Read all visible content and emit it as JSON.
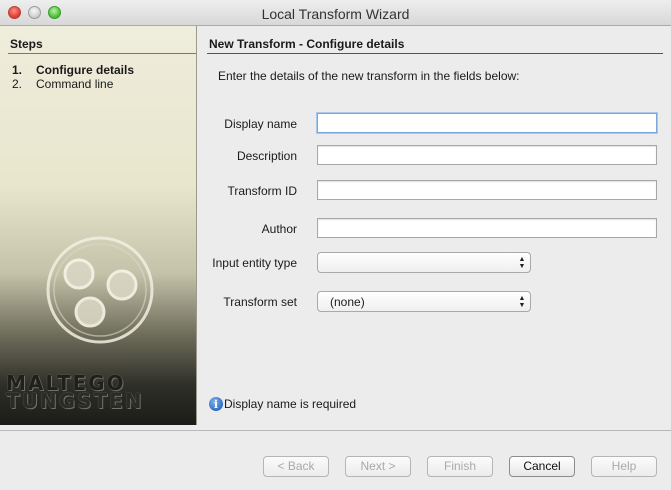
{
  "window": {
    "title": "Local Transform Wizard"
  },
  "sidebar": {
    "heading": "Steps",
    "steps": [
      {
        "num": "1.",
        "label": "Configure details",
        "active": true
      },
      {
        "num": "2.",
        "label": "Command line",
        "active": false
      }
    ],
    "brand_line1": "MALTEGO",
    "brand_line2": "TUNGSTEN"
  },
  "main": {
    "title": "New Transform - Configure details",
    "intro": "Enter the details of the new transform in the fields below:",
    "fields": {
      "display_name": {
        "label": "Display name",
        "value": ""
      },
      "description": {
        "label": "Description",
        "value": ""
      },
      "transform_id": {
        "label": "Transform ID",
        "value": ""
      },
      "author": {
        "label": "Author",
        "value": ""
      },
      "input_entity_type": {
        "label": "Input entity type",
        "value": ""
      },
      "transform_set": {
        "label": "Transform set",
        "value": "(none)"
      }
    },
    "status_message": "Display name is required"
  },
  "buttons": {
    "back": "< Back",
    "next": "Next >",
    "finish": "Finish",
    "cancel": "Cancel",
    "help": "Help"
  },
  "icons": {
    "info": "info-icon",
    "close": "close-icon",
    "minimize": "minimize-icon",
    "maximize": "maximize-icon"
  }
}
